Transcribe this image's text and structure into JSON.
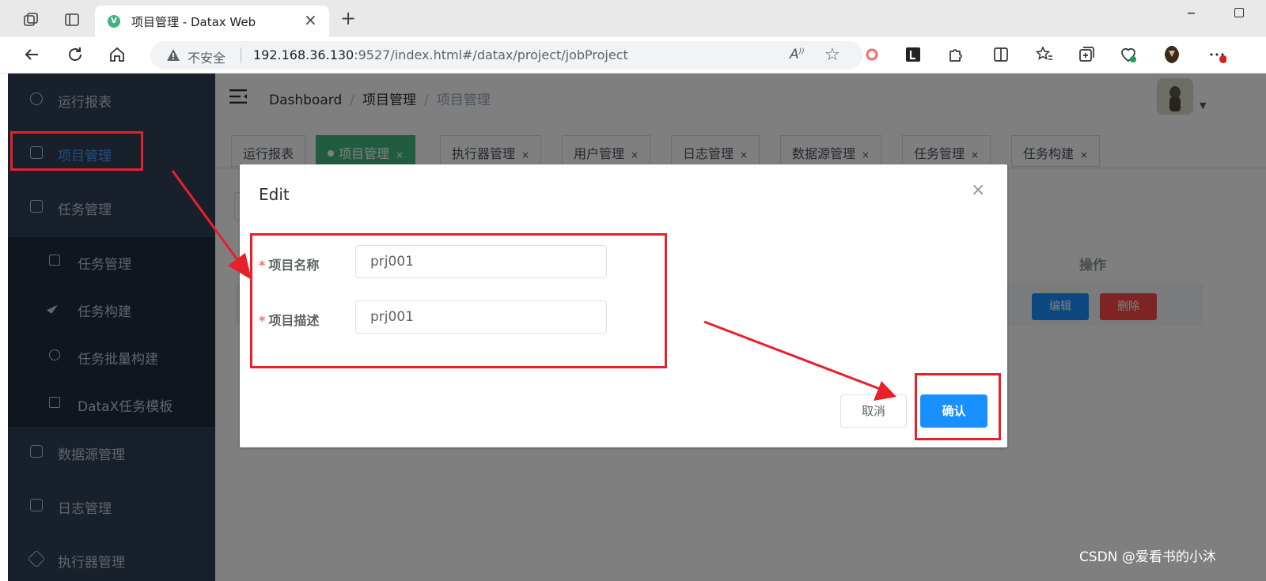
{
  "browser": {
    "tab_title": "项目管理 - Datax Web",
    "favicon_letter": "V",
    "insecure_label": "不安全",
    "url_host": "192.168.36.130",
    "url_rest": ":9527/index.html#/datax/project/jobProject"
  },
  "sidebar": {
    "items": [
      {
        "label": "运行报表",
        "icon": "dashboard-icon"
      },
      {
        "label": "项目管理",
        "icon": "project-icon",
        "active": true
      },
      {
        "label": "任务管理",
        "icon": "monitor-icon"
      },
      {
        "label": "数据源管理",
        "icon": "database-icon"
      },
      {
        "label": "日志管理",
        "icon": "log-icon"
      },
      {
        "label": "执行器管理",
        "icon": "executor-icon"
      }
    ],
    "subitems": [
      {
        "label": "任务管理",
        "icon": "task-icon"
      },
      {
        "label": "任务构建",
        "icon": "send-icon"
      },
      {
        "label": "任务批量构建",
        "icon": "batch-icon"
      },
      {
        "label": "DataX任务模板",
        "icon": "template-icon"
      }
    ]
  },
  "header": {
    "breadcrumb": [
      "Dashboard",
      "项目管理",
      "项目管理"
    ]
  },
  "tags": [
    {
      "label": "运行报表"
    },
    {
      "label": "项目管理",
      "active": true
    },
    {
      "label": "执行器管理"
    },
    {
      "label": "用户管理"
    },
    {
      "label": "日志管理"
    },
    {
      "label": "数据源管理"
    },
    {
      "label": "任务管理"
    },
    {
      "label": "任务构建"
    }
  ],
  "tag_close": "×",
  "table": {
    "column_actions": "操作",
    "edit_label": "编辑",
    "delete_label": "删除"
  },
  "dialog": {
    "title": "Edit",
    "close": "×",
    "fields": [
      {
        "label": "项目名称",
        "value": "prj001",
        "required": "*"
      },
      {
        "label": "项目描述",
        "value": "prj001",
        "required": "*"
      }
    ],
    "cancel_label": "取消",
    "confirm_label": "确认"
  },
  "watermark": "CSDN @爱看书的小沐",
  "colors": {
    "sidebar_bg": "#304156",
    "primary": "#1890ff",
    "danger": "#ff4949",
    "tag_active": "#42b983",
    "annotation_red": "#e8202a"
  }
}
